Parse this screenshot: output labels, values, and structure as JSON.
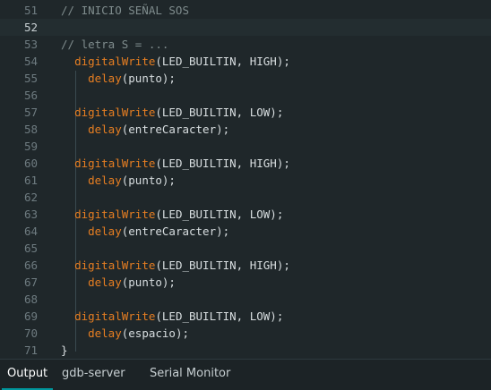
{
  "editor": {
    "lines": [
      {
        "n": "51",
        "segs": [
          {
            "t": "// INICIO SEÑAL SOS",
            "c": "cm"
          }
        ]
      },
      {
        "n": "52",
        "segs": []
      },
      {
        "n": "53",
        "segs": [
          {
            "t": "// letra S = ...",
            "c": "cm"
          }
        ]
      },
      {
        "n": "54",
        "segs": [
          {
            "t": "  "
          },
          {
            "t": "digitalWrite",
            "c": "fn"
          },
          {
            "t": "(LED_BUILTIN, HIGH);"
          }
        ]
      },
      {
        "n": "55",
        "segs": [
          {
            "t": "    "
          },
          {
            "t": "delay",
            "c": "fn"
          },
          {
            "t": "(punto);"
          }
        ]
      },
      {
        "n": "56",
        "segs": []
      },
      {
        "n": "57",
        "segs": [
          {
            "t": "  "
          },
          {
            "t": "digitalWrite",
            "c": "fn"
          },
          {
            "t": "(LED_BUILTIN, LOW);"
          }
        ]
      },
      {
        "n": "58",
        "segs": [
          {
            "t": "    "
          },
          {
            "t": "delay",
            "c": "fn"
          },
          {
            "t": "(entreCaracter);"
          }
        ]
      },
      {
        "n": "59",
        "segs": []
      },
      {
        "n": "60",
        "segs": [
          {
            "t": "  "
          },
          {
            "t": "digitalWrite",
            "c": "fn"
          },
          {
            "t": "(LED_BUILTIN, HIGH);"
          }
        ]
      },
      {
        "n": "61",
        "segs": [
          {
            "t": "    "
          },
          {
            "t": "delay",
            "c": "fn"
          },
          {
            "t": "(punto);"
          }
        ]
      },
      {
        "n": "62",
        "segs": []
      },
      {
        "n": "63",
        "segs": [
          {
            "t": "  "
          },
          {
            "t": "digitalWrite",
            "c": "fn"
          },
          {
            "t": "(LED_BUILTIN, LOW);"
          }
        ]
      },
      {
        "n": "64",
        "segs": [
          {
            "t": "    "
          },
          {
            "t": "delay",
            "c": "fn"
          },
          {
            "t": "(entreCaracter);"
          }
        ]
      },
      {
        "n": "65",
        "segs": []
      },
      {
        "n": "66",
        "segs": [
          {
            "t": "  "
          },
          {
            "t": "digitalWrite",
            "c": "fn"
          },
          {
            "t": "(LED_BUILTIN, HIGH);"
          }
        ]
      },
      {
        "n": "67",
        "segs": [
          {
            "t": "    "
          },
          {
            "t": "delay",
            "c": "fn"
          },
          {
            "t": "(punto);"
          }
        ]
      },
      {
        "n": "68",
        "segs": []
      },
      {
        "n": "69",
        "segs": [
          {
            "t": "  "
          },
          {
            "t": "digitalWrite",
            "c": "fn"
          },
          {
            "t": "(LED_BUILTIN, LOW);"
          }
        ]
      },
      {
        "n": "70",
        "segs": [
          {
            "t": "    "
          },
          {
            "t": "delay",
            "c": "fn"
          },
          {
            "t": "(espacio);"
          }
        ]
      },
      {
        "n": "71",
        "segs": [
          {
            "t": "}"
          }
        ]
      }
    ],
    "current_line": "52"
  },
  "panel": {
    "tabs": [
      {
        "label": "Output",
        "active": true
      },
      {
        "label": "gdb-server",
        "active": false
      },
      {
        "label": "Serial Monitor",
        "active": false
      }
    ]
  },
  "colors": {
    "background": "#1f272a",
    "comment": "#7f8c8d",
    "function": "#e67e22",
    "text": "#d8dee0",
    "accent": "#00979d"
  }
}
